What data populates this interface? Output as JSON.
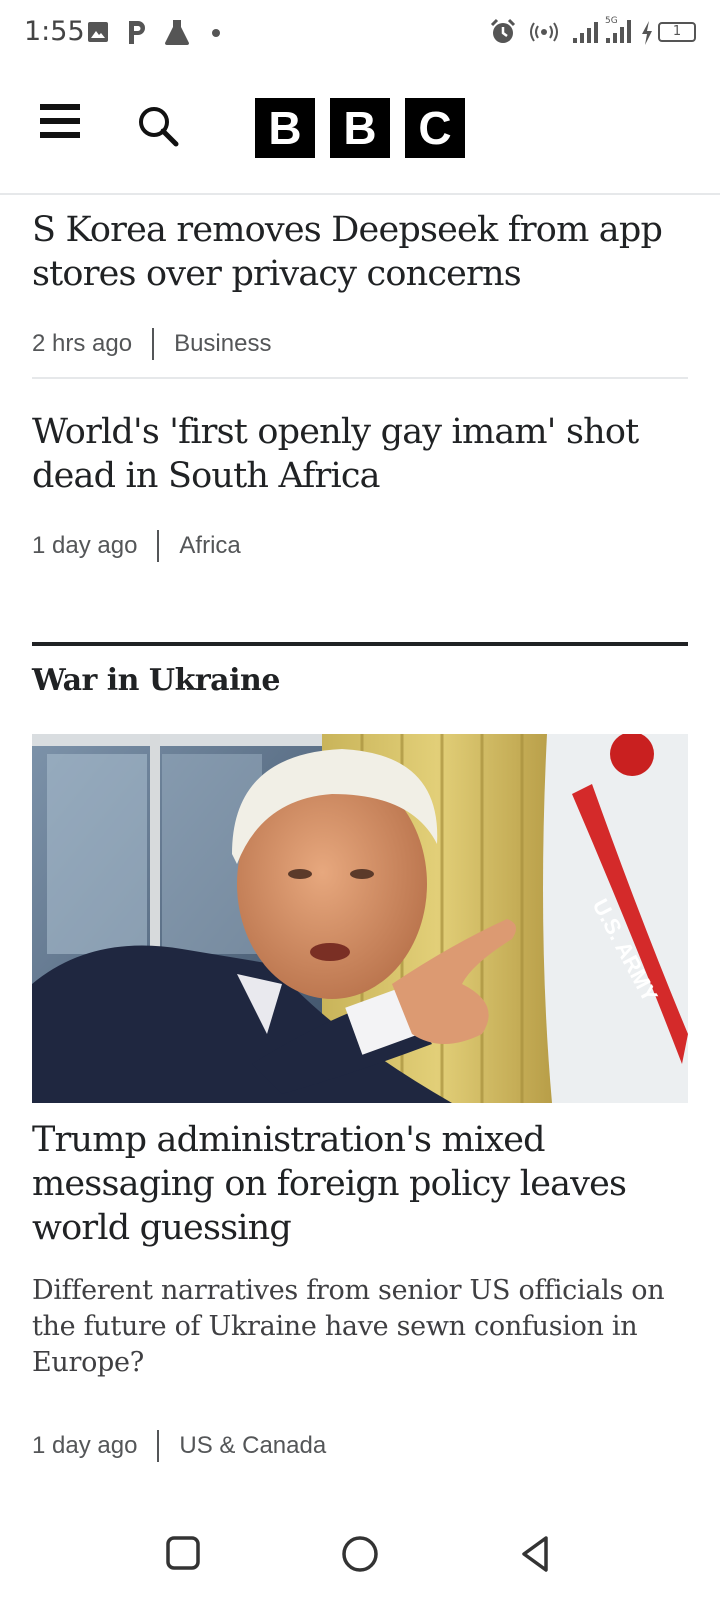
{
  "status_bar": {
    "time": "1:55",
    "icons": [
      "image-icon",
      "parking-icon",
      "flask-icon",
      "dot-icon",
      "alarm-icon",
      "hotspot-icon",
      "signal-icon",
      "signal-5g-icon",
      "charging-icon",
      "battery-icon"
    ],
    "network_label": "5G",
    "battery_level": "1"
  },
  "header": {
    "logo_letters": [
      "B",
      "B",
      "C"
    ]
  },
  "articles": [
    {
      "headline": "S Korea removes Deepseek from app stores over privacy concerns",
      "time": "2 hrs ago",
      "category": "Business"
    },
    {
      "headline": "World's 'first openly gay imam' shot dead in South Africa",
      "time": "1 day ago",
      "category": "Africa"
    }
  ],
  "section": {
    "title": "War in Ukraine",
    "feature": {
      "image_flag_text": "U.S. ARMY",
      "headline": "Trump administration's mixed messaging on foreign policy leaves world guessing",
      "summary": "Different narratives from senior US officials on the future of Ukraine have sewn confusion in Europe?",
      "time": "1 day ago",
      "category": "US & Canada"
    }
  },
  "nav_bar": {
    "buttons": [
      "recent-apps-icon",
      "home-icon",
      "back-icon"
    ]
  }
}
